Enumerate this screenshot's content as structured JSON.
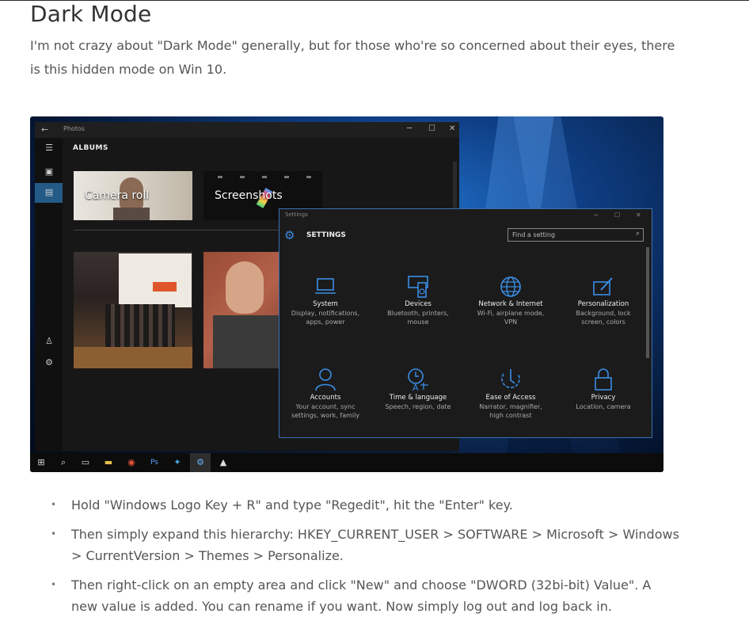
{
  "article": {
    "title": "Dark Mode",
    "intro": "I'm not crazy about \"Dark Mode\" generally, but for those who're so concerned about their eyes, there is this hidden mode on Win 10."
  },
  "screenshot": {
    "photos": {
      "app_title": "Photos",
      "section": "ALBUMS",
      "albums": [
        {
          "caption": "Camera roll"
        },
        {
          "caption": "Screenshots"
        }
      ]
    },
    "settings": {
      "window_title": "Settings",
      "heading": "SETTINGS",
      "search_placeholder": "Find a setting",
      "categories": [
        {
          "name": "System",
          "desc1": "Display, notifications,",
          "desc2": "apps, power",
          "icon": "laptop-icon"
        },
        {
          "name": "Devices",
          "desc1": "Bluetooth, printers,",
          "desc2": "mouse",
          "icon": "devices-icon"
        },
        {
          "name": "Network & Internet",
          "desc1": "Wi-Fi, airplane mode,",
          "desc2": "VPN",
          "icon": "globe-icon"
        },
        {
          "name": "Personalization",
          "desc1": "Background, lock",
          "desc2": "screen, colors",
          "icon": "paint-icon"
        },
        {
          "name": "Accounts",
          "desc1": "Your account, sync",
          "desc2": "settings, work, family",
          "icon": "person-icon"
        },
        {
          "name": "Time & language",
          "desc1": "Speech, region, date",
          "desc2": "",
          "icon": "clock-language-icon"
        },
        {
          "name": "Ease of Access",
          "desc1": "Narrator, magnifier,",
          "desc2": "high contrast",
          "icon": "ease-of-access-icon"
        },
        {
          "name": "Privacy",
          "desc1": "Location, camera",
          "desc2": "",
          "icon": "lock-icon"
        }
      ]
    },
    "colors": {
      "accent": "#3a8ee6",
      "rail_selected": "#245a86"
    }
  },
  "bullets": [
    "Hold \"Windows Logo Key + R\" and type \"Regedit\", hit the \"Enter\" key.",
    "Then simply expand this hierarchy: HKEY_CURRENT_USER > SOFTWARE > Microsoft > Windows > CurrentVersion > Themes > Personalize.",
    "Then right-click on an empty area and click \"New\" and choose \"DWORD (32bi-bit) Value\". A new value is added. You can rename if you want. Now simply log out and log back in."
  ]
}
